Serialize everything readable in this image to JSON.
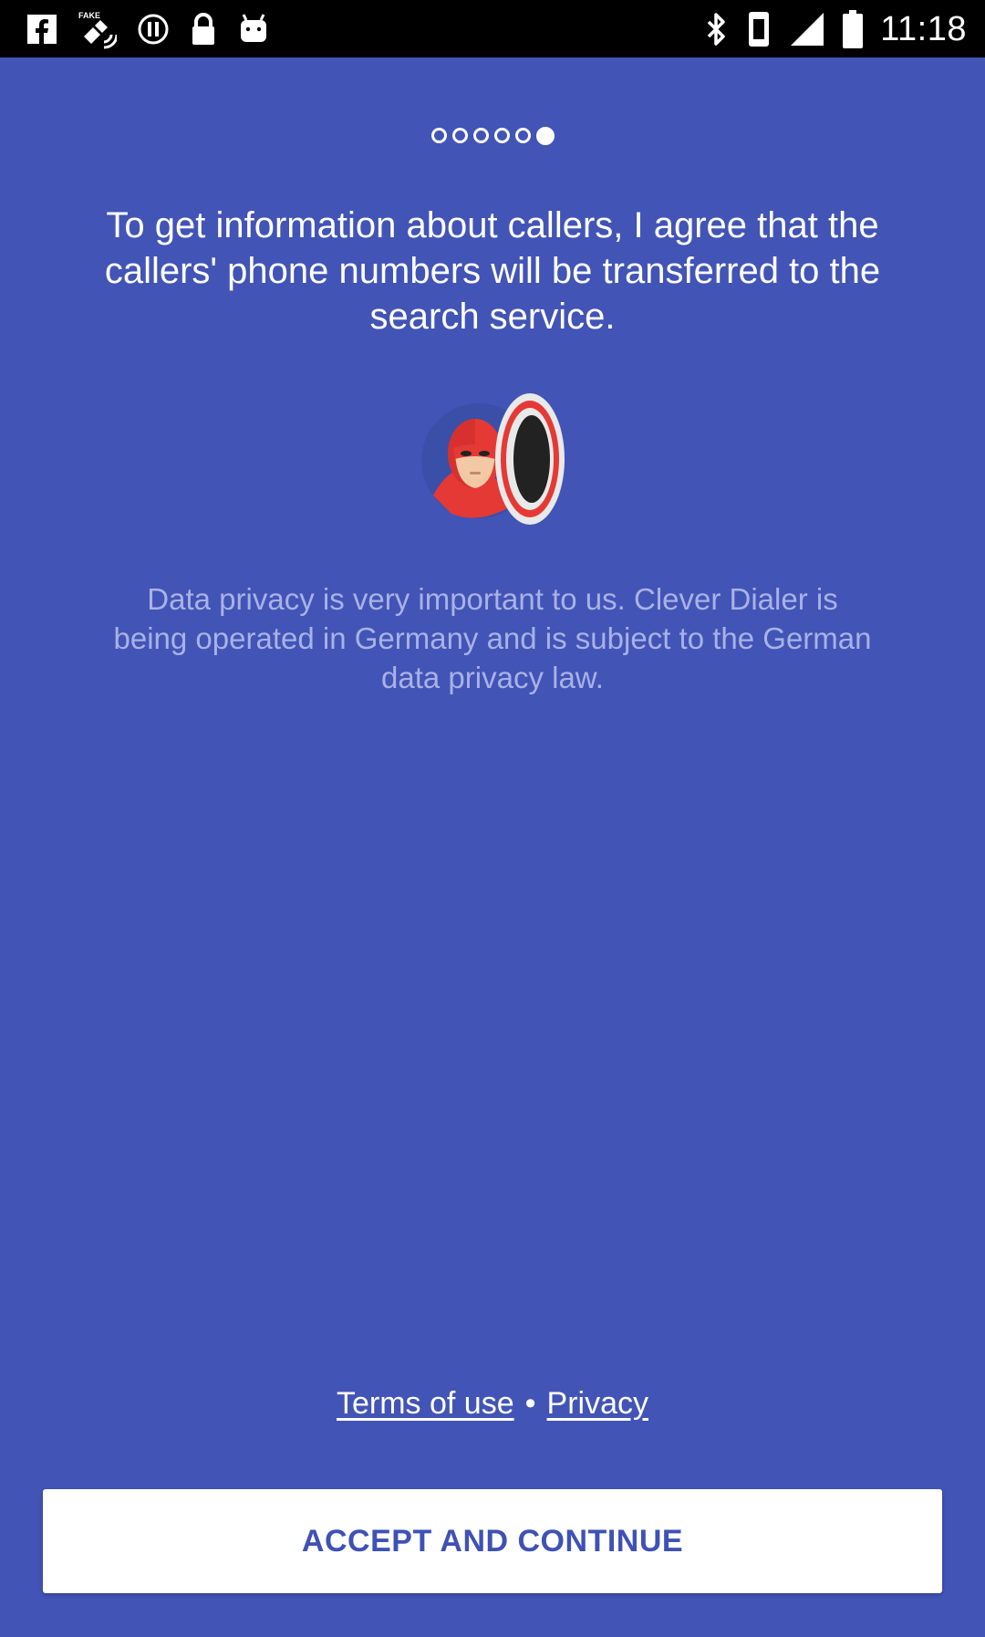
{
  "status_bar": {
    "time": "11:18",
    "left_icons": [
      "facebook-icon",
      "fake-gps-icon",
      "circle-info-icon",
      "lock-icon",
      "android-icon"
    ],
    "right_icons": [
      "bluetooth-icon",
      "vibrate-icon",
      "signal-icon",
      "battery-icon"
    ]
  },
  "onboarding": {
    "page_count": 6,
    "active_page": 6,
    "headline": "To get information about callers, I agree that the callers' phone numbers will be transferred to the search service.",
    "illustration": "hero-with-shield-icon",
    "privacy_note": "Data privacy is very important to us. Clever Dialer is being operated in Germany and is subject to the German data privacy law."
  },
  "footer": {
    "terms_label": "Terms of use",
    "separator": "•",
    "privacy_label": "Privacy"
  },
  "accept_button": {
    "label": "ACCEPT AND CONTINUE"
  },
  "colors": {
    "background": "#4254b6",
    "button_text": "#3f51b5",
    "note_text": "#a8b2e6"
  }
}
